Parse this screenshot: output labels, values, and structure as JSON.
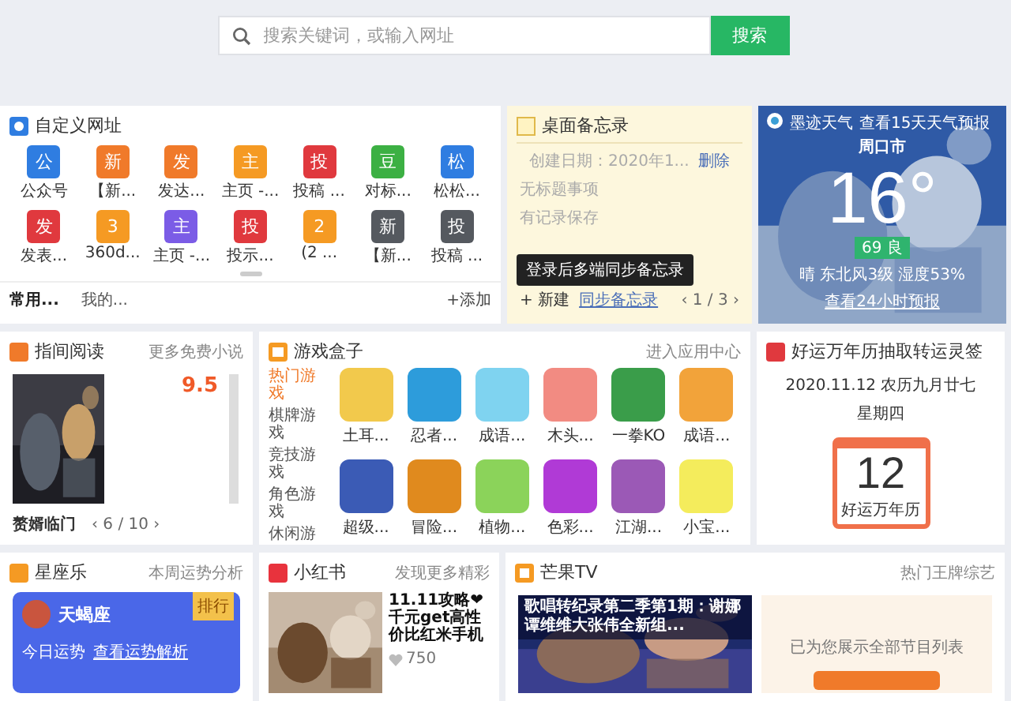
{
  "search": {
    "placeholder": "搜索关键词，或输入网址",
    "button": "搜索"
  },
  "custom_sites": {
    "title": "自定义网址",
    "items": [
      {
        "icon": "公",
        "label": "公众号",
        "color": "#2f7de1"
      },
      {
        "icon": "新",
        "label": "【新...",
        "color": "#f07a2a"
      },
      {
        "icon": "发",
        "label": "发达...",
        "color": "#f07a2a"
      },
      {
        "icon": "主",
        "label": "主页 -...",
        "color": "#f59a23"
      },
      {
        "icon": "投",
        "label": "投稿 ...",
        "color": "#e0393e"
      },
      {
        "icon": "豆",
        "label": "对标...",
        "color": "#3cb043"
      },
      {
        "icon": "松",
        "label": "松松...",
        "color": "#2f7de1"
      },
      {
        "icon": "发",
        "label": "发表...",
        "color": "#e0393e"
      },
      {
        "icon": "3",
        "label": "360d...",
        "color": "#f59a23"
      },
      {
        "icon": "主",
        "label": "主页 -...",
        "color": "#7b5ce6"
      },
      {
        "icon": "投",
        "label": "投示...",
        "color": "#e0393e"
      },
      {
        "icon": "2",
        "label": "(2 ...",
        "color": "#f59a23"
      },
      {
        "icon": "新",
        "label": "【新...",
        "color": "#55595f"
      },
      {
        "icon": "投",
        "label": "投稿 ...",
        "color": "#55595f"
      }
    ],
    "tabs": [
      {
        "label": "常用...",
        "selected": true
      },
      {
        "label": "我的...",
        "selected": false
      }
    ],
    "add": "+添加"
  },
  "memo": {
    "title": "桌面备忘录",
    "date": "创建日期：2020年1...",
    "delete": "删除",
    "lines": [
      "无标题事项",
      "有记录保存"
    ],
    "tooltip": "登录后多端同步备忘录",
    "new": "+ 新建",
    "sync": "同步备忘录",
    "pager": "‹ 1 / 3 ›"
  },
  "weather": {
    "source": "墨迹天气",
    "forecast_link": "查看15天天气预报",
    "city": "周口市",
    "temperature": "16°",
    "aqi": "69 良",
    "conditions": "晴  东北风3级  湿度53%",
    "hourly_link": "查看24小时预报"
  },
  "reading": {
    "title": "指间阅读",
    "more": "更多免费小说",
    "rating": "9.5",
    "book_title": "赘婿临门",
    "pager": "‹ 6 / 10 ›"
  },
  "games": {
    "title": "游戏盒子",
    "more": "进入应用中心",
    "categories": [
      {
        "label": "热门游戏",
        "selected": true
      },
      {
        "label": "棋牌游戏",
        "selected": false
      },
      {
        "label": "竞技游戏",
        "selected": false
      },
      {
        "label": "角色游戏",
        "selected": false
      },
      {
        "label": "休闲游",
        "selected": false
      }
    ],
    "items": [
      {
        "label": "土耳...",
        "color": "#f2c94c"
      },
      {
        "label": "忍者...",
        "color": "#2d9cdb"
      },
      {
        "label": "成语...",
        "color": "#7fd3f0"
      },
      {
        "label": "木头...",
        "color": "#f28b82"
      },
      {
        "label": "一拳KO",
        "color": "#3a9d4a"
      },
      {
        "label": "成语...",
        "color": "#f2a33a"
      },
      {
        "label": "超级...",
        "color": "#3b5bb5"
      },
      {
        "label": "冒险...",
        "color": "#e08a1e"
      },
      {
        "label": "植物...",
        "color": "#8bd35a"
      },
      {
        "label": "色彩...",
        "color": "#b03ad6"
      },
      {
        "label": "江湖...",
        "color": "#9b59b6"
      },
      {
        "label": "小宝...",
        "color": "#f4ec5c"
      }
    ]
  },
  "calendar": {
    "title": "好运万年历抽取转运灵签",
    "date": "2020.11.12  农历九月廿七",
    "weekday": "星期四",
    "day": "12",
    "caption": "好运万年历"
  },
  "astro": {
    "title": "星座乐",
    "more": "本周运势分析",
    "sign": "天蝎座",
    "badge": "排行",
    "today": "今日运势",
    "link": "查看运势解析"
  },
  "xiaohongshu": {
    "title": "小红书",
    "more": "发现更多精彩",
    "post_title": "11.11攻略❤千元get高性价比红米手机",
    "likes": "750"
  },
  "mango": {
    "title": "芒果TV",
    "more": "热门王牌综艺",
    "video_caption": "歌唱转纪录第二季第1期：谢娜谭维维大张伟全新组...",
    "ad_text": "已为您展示全部节目列表"
  }
}
